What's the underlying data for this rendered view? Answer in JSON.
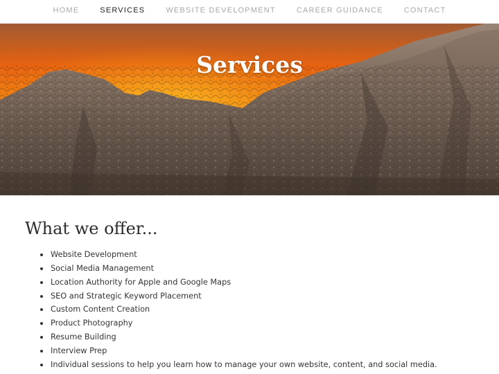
{
  "nav": {
    "items": [
      {
        "label": "HOME",
        "active": false
      },
      {
        "label": "SERVICES",
        "active": true
      },
      {
        "label": "WEBSITE DEVELOPMENT",
        "active": false
      },
      {
        "label": "CAREER GUIDANCE",
        "active": false
      },
      {
        "label": "CONTACT",
        "active": false
      }
    ]
  },
  "hero": {
    "title": "Services",
    "sky_colors": [
      "#f07a10",
      "#e35b18",
      "#9a6a55"
    ],
    "rock_color": "#7a6a5e"
  },
  "main": {
    "heading": "What we offer...",
    "offerings": [
      "Website Development",
      "Social Media Management",
      "Location Authority for Apple and Google Maps",
      "SEO and Strategic Keyword Placement",
      "Custom Content Creation",
      "Product Photography",
      "Resume Building",
      "Interview Prep",
      "Individual sessions to help you learn how to manage your own website, content, and social media."
    ]
  }
}
